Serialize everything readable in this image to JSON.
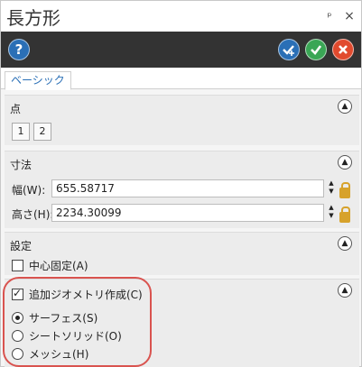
{
  "window": {
    "title": "長方形",
    "pin_glyph": "ᵖ",
    "close_glyph": "×"
  },
  "toolbar": {
    "help_label": "?",
    "icons": [
      "help-icon",
      "apply-plus-icon",
      "ok-check-icon",
      "cancel-x-icon"
    ],
    "colors": {
      "bar": "#333333",
      "help": "#2a6fb6",
      "ok": "#3aa655",
      "cancel": "#e14a2e"
    }
  },
  "tabs": [
    {
      "label": "ベーシック",
      "active": true
    }
  ],
  "sections": {
    "points": {
      "title": "点",
      "buttons": [
        "1",
        "2"
      ]
    },
    "dimensions": {
      "title": "寸法",
      "width_label": "幅(W):",
      "width_value": "655.58717",
      "height_label": "高さ(H):",
      "height_value": "2234.30099"
    },
    "settings": {
      "title": "設定",
      "center_fixed_label": "中心固定(A)",
      "center_fixed_checked": false
    },
    "additional_geometry": {
      "title": "追加ジオメトリ作成(C)",
      "checked": true,
      "options": [
        {
          "label": "サーフェス(S)",
          "selected": true
        },
        {
          "label": "シートソリッド(O)",
          "selected": false
        },
        {
          "label": "メッシュ(H)",
          "selected": false
        }
      ]
    }
  },
  "collapse_glyph": "▲",
  "spin_up_glyph": "▲",
  "spin_down_glyph": "▼",
  "annotation_color": "#d9534f"
}
